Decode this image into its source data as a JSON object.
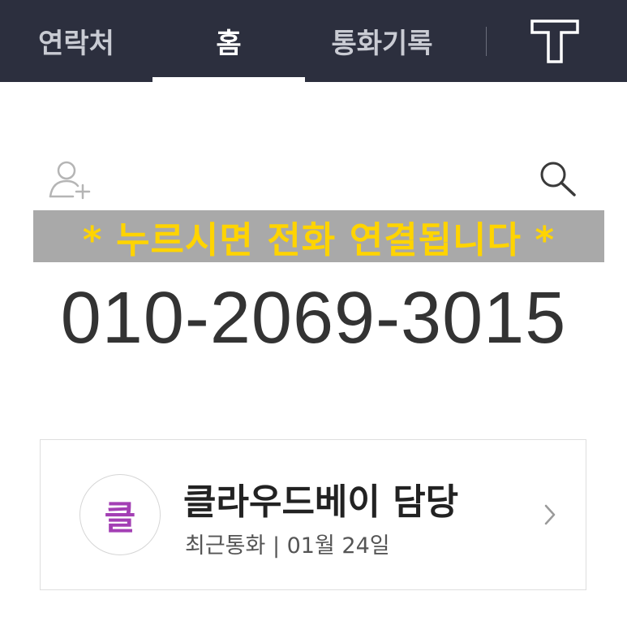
{
  "tabs": [
    {
      "label": "연락처",
      "active": false
    },
    {
      "label": "홈",
      "active": true
    },
    {
      "label": "통화기록",
      "active": false
    }
  ],
  "logo": {
    "icon": "t-logo-icon"
  },
  "actions": {
    "add_contact_icon": "add-person-icon",
    "search_icon": "search-icon"
  },
  "banner": {
    "text": "* 누르시면 전화 연결됩니다 *"
  },
  "phone": {
    "number": "010-2069-3015"
  },
  "contact": {
    "avatar_letter": "클",
    "name": "클라우드베이 담당",
    "subtitle": "최근통화 | 01월 24일"
  },
  "colors": {
    "topbar": "#2c2f3e",
    "banner_bg": "#a9a9a9",
    "banner_text": "#ffd400",
    "avatar_letter": "#a33fb4"
  }
}
